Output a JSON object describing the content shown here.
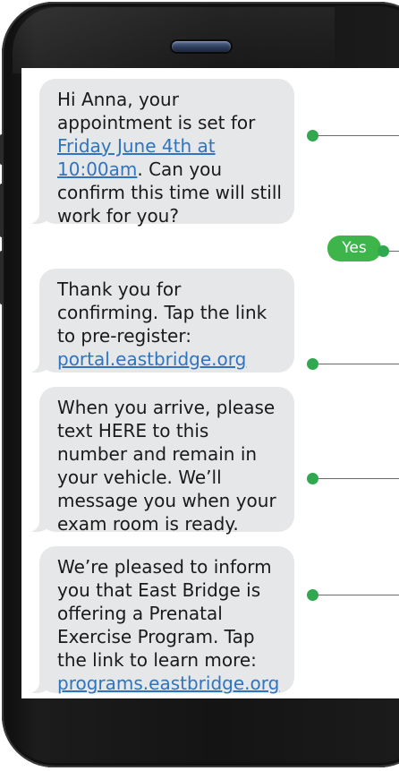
{
  "device": {
    "frame_color": "#141414",
    "speaker_icon": "earpiece-speaker"
  },
  "colors": {
    "incoming_bubble": "#e6e7e8",
    "outgoing_bubble": "#3db54a",
    "link": "#2f74c0",
    "callout_dot": "#2fa84f"
  },
  "messages": [
    {
      "direction": "incoming",
      "text_before": "Hi Anna, your appointment is set for ",
      "link": "Friday June 4th at 10:00am",
      "text_after": ". Can you confirm this time will still work for you?"
    },
    {
      "direction": "outgoing",
      "text": "Yes"
    },
    {
      "direction": "incoming",
      "text_before": "Thank you for confirming. Tap the link to pre-register: ",
      "link": "portal.eastbridge.org"
    },
    {
      "direction": "incoming",
      "text_before": "When you arrive, please text HERE to this number and remain in your vehicle. We’ll message you when your exam room is ready."
    },
    {
      "direction": "incoming",
      "text_before": "We’re pleased to inform you that East Bridge is offering a Prenatal Exercise Program. Tap the link to learn more: ",
      "link": "programs.eastbridge.org"
    }
  ]
}
